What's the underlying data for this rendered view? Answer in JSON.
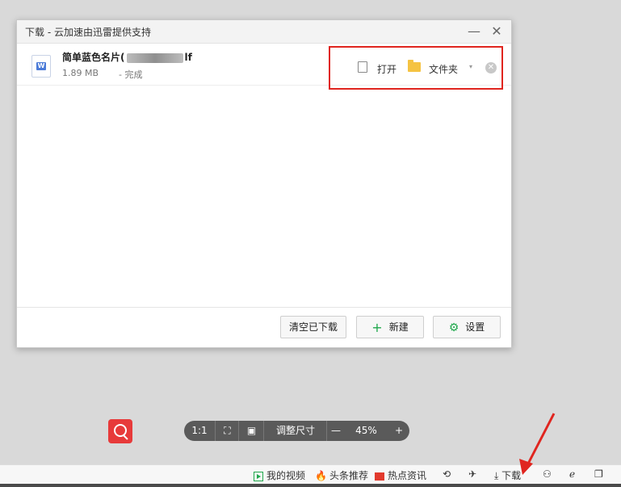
{
  "dialog": {
    "title": "下载 - 云加速由迅雷提供支持",
    "controls": {
      "minimize": "—",
      "close": "✕"
    }
  },
  "download_item": {
    "file_name_prefix": "简单蓝色名片(",
    "file_name_suffix": "lf",
    "file_icon_letter": "W",
    "size": "1.89 MB",
    "status": "- 完成",
    "actions": {
      "open_label": "打开",
      "folder_label": "文件夹",
      "dropdown": "▾",
      "remove": "✕"
    }
  },
  "footer_buttons": {
    "clear": "清空已下载",
    "new": "新建",
    "settings": "设置"
  },
  "viewer_toolbar": {
    "ratio": "1:1",
    "fit_icon": "⛶",
    "crop_icon": "▣",
    "resize": "调整尺寸",
    "zoom_out": "—",
    "zoom": "45%",
    "zoom_in": "+"
  },
  "statusbar": {
    "video": "我的视频",
    "headline": "头条推荐",
    "hot_news": "热点资讯",
    "download": "下载",
    "icons": [
      "⟲",
      "✈",
      "⚇",
      "ℯ",
      "❐"
    ]
  },
  "colors": {
    "accent_green": "#20a84c",
    "highlight_red": "#e0251f"
  }
}
